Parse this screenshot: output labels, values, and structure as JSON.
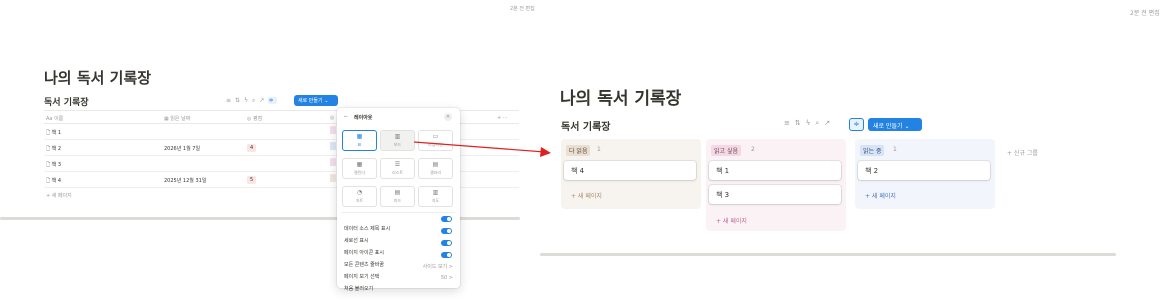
{
  "left": {
    "edit_time": "2분 전 편집",
    "page_title": "나의 독서 기록장",
    "db_title": "독서 기록장",
    "new_button": "새로 만들기",
    "columns": [
      "Aa 이름",
      "읽은 날짜",
      "평점"
    ],
    "rows": [
      {
        "name": "책 1",
        "date": "",
        "rating": ""
      },
      {
        "name": "책 2",
        "date": "2026년 1월 7일",
        "rating": "4"
      },
      {
        "name": "책 3",
        "date": "",
        "rating": ""
      },
      {
        "name": "책 4",
        "date": "2025년 12월 31일",
        "rating": "5"
      }
    ],
    "new_page": "+ 새 페이지",
    "plus_more": "+ ···",
    "layout_menu": {
      "title": "레이아웃",
      "options": [
        "표",
        "보드",
        "타임라인",
        "캘린더",
        "리스트",
        "갤러리",
        "차트",
        "피드",
        "지도"
      ],
      "settings": [
        {
          "label": "데이터 소스 제목 표시"
        },
        {
          "label": "세로선 표시"
        },
        {
          "label": "페이지 아이콘 표시"
        },
        {
          "label": "모든 콘텐츠 줄바꿈"
        }
      ],
      "page_view_label": "페이지 보기 선택",
      "page_view_value": "사이드 보기 >",
      "load_limit_label": "처음 불러오기",
      "load_limit_value": "50 >"
    }
  },
  "right": {
    "edit_time": "2분 전 편집",
    "page_title": "나의 독서 기록장",
    "db_title": "독서 기록장",
    "new_button": "새로 만들기",
    "groups": [
      {
        "label": "다 읽음",
        "count": "1",
        "cards": [
          "책 4"
        ],
        "new_page": "+ 새 페이지"
      },
      {
        "label": "읽고 싶음",
        "count": "2",
        "cards": [
          "책 1",
          "책 3"
        ],
        "new_page": "+ 새 페이지"
      },
      {
        "label": "읽는 중",
        "count": "1",
        "cards": [
          "책 2"
        ],
        "new_page": "+ 새 페이지"
      }
    ],
    "add_group": "+ 신규 그룹"
  },
  "colors": {
    "accent": "#2383e2",
    "arrow": "#e02020",
    "done": "#f7f3ee",
    "want": "#fbf2f5",
    "reading": "#f2f5fb"
  }
}
